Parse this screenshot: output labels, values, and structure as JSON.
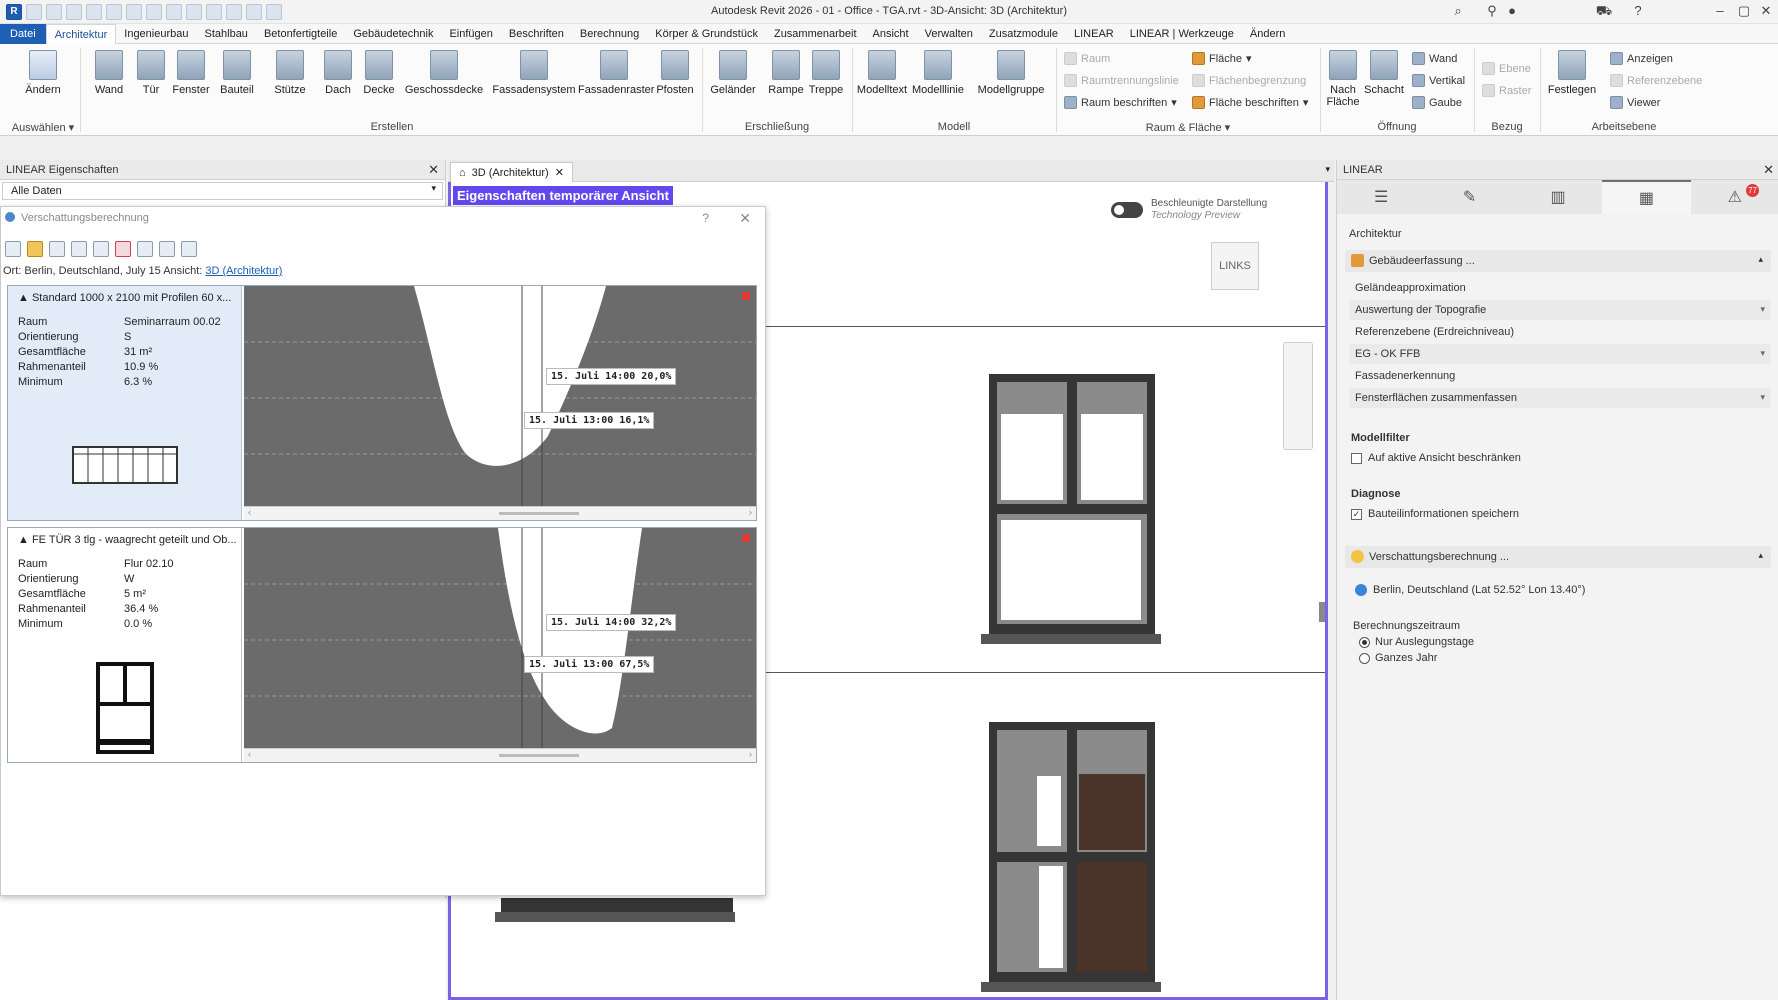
{
  "window": {
    "title": "Autodesk Revit 2026 - 01 - Office - TGA.rvt - 3D-Ansicht: 3D (Architektur)"
  },
  "menu": {
    "tabs": [
      "Datei",
      "Architektur",
      "Ingenieurbau",
      "Stahlbau",
      "Betonfertigteile",
      "Gebäudetechnik",
      "Einfügen",
      "Beschriften",
      "Berechnung",
      "Körper & Grundstück",
      "Zusammenarbeit",
      "Ansicht",
      "Verwalten",
      "Zusatzmodule",
      "LINEAR",
      "LINEAR | Werkzeuge",
      "Ändern"
    ],
    "active": "Architektur"
  },
  "ribbon": {
    "buttons": {
      "aendern": "Ändern",
      "wand": "Wand",
      "tuer": "Tür",
      "fenster": "Fenster",
      "bauteil": "Bauteil",
      "stuetze": "Stütze",
      "dach": "Dach",
      "decke": "Decke",
      "geschossdecke": "Geschossdecke",
      "fassadensystem": "Fassadensystem",
      "fassadenraster": "Fassadenraster",
      "pfosten": "Pfosten",
      "gelaender": "Geländer",
      "rampe": "Rampe",
      "treppe": "Treppe",
      "modelltext": "Modelltext",
      "modelllinie": "Modelllinie",
      "modellgruppe": "Modellgruppe",
      "nach_flaeche": "Nach Fläche",
      "schacht": "Schacht",
      "festlegen": "Festlegen"
    },
    "small": {
      "raum": "Raum",
      "raumtrennungslinie": "Raumtrennungslinie",
      "raum_beschriften": "Raum beschriften",
      "flaeche": "Fläche",
      "flaechenbegrenzung": "Flächenbegrenzung",
      "flaeche_beschriften": "Fläche beschriften",
      "wand": "Wand",
      "vertikal": "Vertikal",
      "gaube": "Gaube",
      "ebene": "Ebene",
      "raster": "Raster",
      "anzeigen": "Anzeigen",
      "referenzebene": "Referenzebene",
      "viewer": "Viewer"
    },
    "panels": {
      "auswaehlen": "Auswählen",
      "erstellen": "Erstellen",
      "erschliessung": "Erschließung",
      "modell": "Modell",
      "raum_flaeche": "Raum & Fläche",
      "oeffnung": "Öffnung",
      "bezug": "Bezug",
      "arbeitsebene": "Arbeitsebene"
    }
  },
  "left_panel": {
    "title": "LINEAR Eigenschaften",
    "filter": "Alle Daten"
  },
  "view": {
    "tab": "3D (Architektur)",
    "temp_label": "Eigenschaften temporärer Ansicht",
    "toggle_label": "Beschleunigte Darstellung",
    "toggle_sub": "Technology Preview",
    "viewcube": "LINKS"
  },
  "dialog": {
    "title": "Verschattungsberechnung",
    "location_prefix": "Ort: Berlin, Deutschland, July 15  Ansicht:",
    "location_link": "3D (Architektur)",
    "labels": {
      "raum": "Raum",
      "orientierung": "Orientierung",
      "gesamtflaeche": "Gesamtfläche",
      "rahmenanteil": "Rahmenanteil",
      "minimum": "Minimum"
    },
    "cards": [
      {
        "title": "Standard 1000 x 2100 mit Profilen 60 x...",
        "raum": "Seminarraum 00.02",
        "orientierung": "S",
        "gesamtflaeche": "31 m²",
        "rahmenanteil": "10.9 %",
        "minimum": "6.3 %",
        "annotations": [
          "15. Juli 14:00 20,0%",
          "15. Juli 13:00 16,1%"
        ]
      },
      {
        "title": "FE TÜR 3 tlg - waagrecht geteilt und Ob...",
        "raum": "Flur 02.10",
        "orientierung": "W",
        "gesamtflaeche": "5 m²",
        "rahmenanteil": "36.4 %",
        "minimum": "0.0 %",
        "annotations": [
          "15. Juli 14:00 32,2%",
          "15. Juli 13:00 67,5%"
        ]
      }
    ]
  },
  "right_panel": {
    "title": "LINEAR",
    "badge": "77",
    "heading": "Architektur",
    "gebaeude_section": "Gebäudeerfassung ...",
    "rows": {
      "gelaende": "Geländeapproximation",
      "topografie": "Auswertung der Topografie",
      "referenz": "Referenzebene (Erdreichniveau)",
      "eg": "EG - OK FFB",
      "fassade": "Fassadenerkennung",
      "fenster": "Fensterflächen zusammenfassen"
    },
    "modellfilter": "Modellfilter",
    "check_ansicht": "Auf aktive Ansicht beschränken",
    "diagnose": "Diagnose",
    "check_bauteil": "Bauteilinformationen speichern",
    "shade_section": "Verschattungsberechnung ...",
    "location": "Berlin, Deutschland (Lat 52.52° Lon 13.40°)",
    "zeitraum": "Berechnungszeitraum",
    "radio_1": "Nur Auslegungstage",
    "radio_2": "Ganzes Jahr"
  },
  "colors": {
    "accent": "#1e5fb4",
    "view_border": "#7b62e6",
    "temp_label_bg": "#6148ee",
    "chart_bg": "#6b6b6b",
    "info_bg": "#e1ecf8"
  },
  "icons": [
    "revit-logo-icon",
    "open-icon",
    "save-icon",
    "undo-icon",
    "redo-icon",
    "print-icon",
    "home-icon",
    "help-icon",
    "cart-icon",
    "user-icon",
    "close-icon",
    "hamburger-icon",
    "edit-icon",
    "columns-icon",
    "calculator-icon",
    "alert-icon",
    "sun-icon",
    "globe-icon"
  ]
}
